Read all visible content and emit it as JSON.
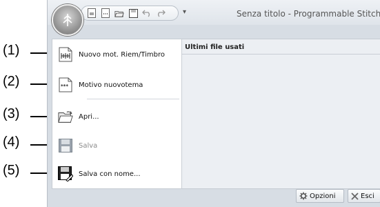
{
  "window": {
    "title": "Senza titolo - Programmable Stitch Cr",
    "qat_dropdown_glyph": "▾"
  },
  "menu": {
    "items": [
      {
        "label": "Nuovo mot. Riem/Timbro",
        "icon": "stitch-pattern-icon",
        "enabled": true
      },
      {
        "label": "Motivo nuovotema",
        "icon": "motif-pattern-icon",
        "enabled": true
      },
      {
        "label": "Apri...",
        "icon": "folder-open-icon",
        "enabled": true
      },
      {
        "label": "Salva",
        "icon": "save-disk-icon",
        "enabled": false
      },
      {
        "label": "Salva con nome...",
        "icon": "save-as-icon",
        "enabled": true
      }
    ],
    "recent_files_title": "Ultimi file usati"
  },
  "bottom_buttons": {
    "options_label": "Opzioni",
    "exit_label": "Esci"
  },
  "callouts": [
    "(1)",
    "(2)",
    "(3)",
    "(4)",
    "(5)"
  ]
}
